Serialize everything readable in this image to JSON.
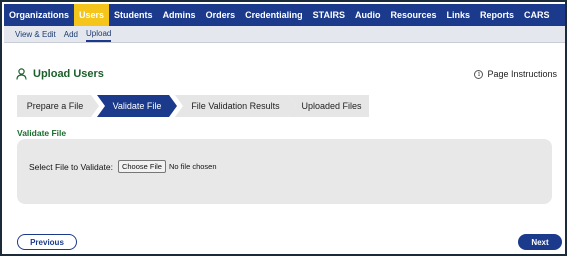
{
  "topnav": {
    "items": [
      {
        "label": "Organizations",
        "active": false
      },
      {
        "label": "Users",
        "active": true
      },
      {
        "label": "Students",
        "active": false
      },
      {
        "label": "Admins",
        "active": false
      },
      {
        "label": "Orders",
        "active": false
      },
      {
        "label": "Credentialing",
        "active": false
      },
      {
        "label": "STAIRS",
        "active": false
      },
      {
        "label": "Audio",
        "active": false
      },
      {
        "label": "Resources",
        "active": false
      },
      {
        "label": "Links",
        "active": false
      },
      {
        "label": "Reports",
        "active": false
      },
      {
        "label": "CARS",
        "active": false
      }
    ]
  },
  "subnav": {
    "items": [
      {
        "label": "View & Edit",
        "active": false
      },
      {
        "label": "Add",
        "active": false
      },
      {
        "label": "Upload",
        "active": true
      }
    ]
  },
  "page": {
    "title": "Upload Users",
    "title_icon": "user-icon",
    "instructions_label": "Page Instructions",
    "instructions_icon": "info-icon"
  },
  "steps": [
    {
      "label": "Prepare a File",
      "active": false
    },
    {
      "label": "Validate File",
      "active": true
    },
    {
      "label": "File Validation Results",
      "active": false
    },
    {
      "label": "Uploaded Files",
      "active": false
    }
  ],
  "section": {
    "label": "Validate File",
    "file_label": "Select File to Validate:",
    "choose_button": "Choose File",
    "no_file_text": "No file chosen"
  },
  "footer": {
    "previous_label": "Previous",
    "next_label": "Next"
  },
  "colors": {
    "nav_bg": "#1b3a8c",
    "nav_active": "#f5c51b",
    "step_active": "#1b3a8c",
    "step_inactive": "#e6e6e6",
    "title_green": "#1b5f2a"
  }
}
